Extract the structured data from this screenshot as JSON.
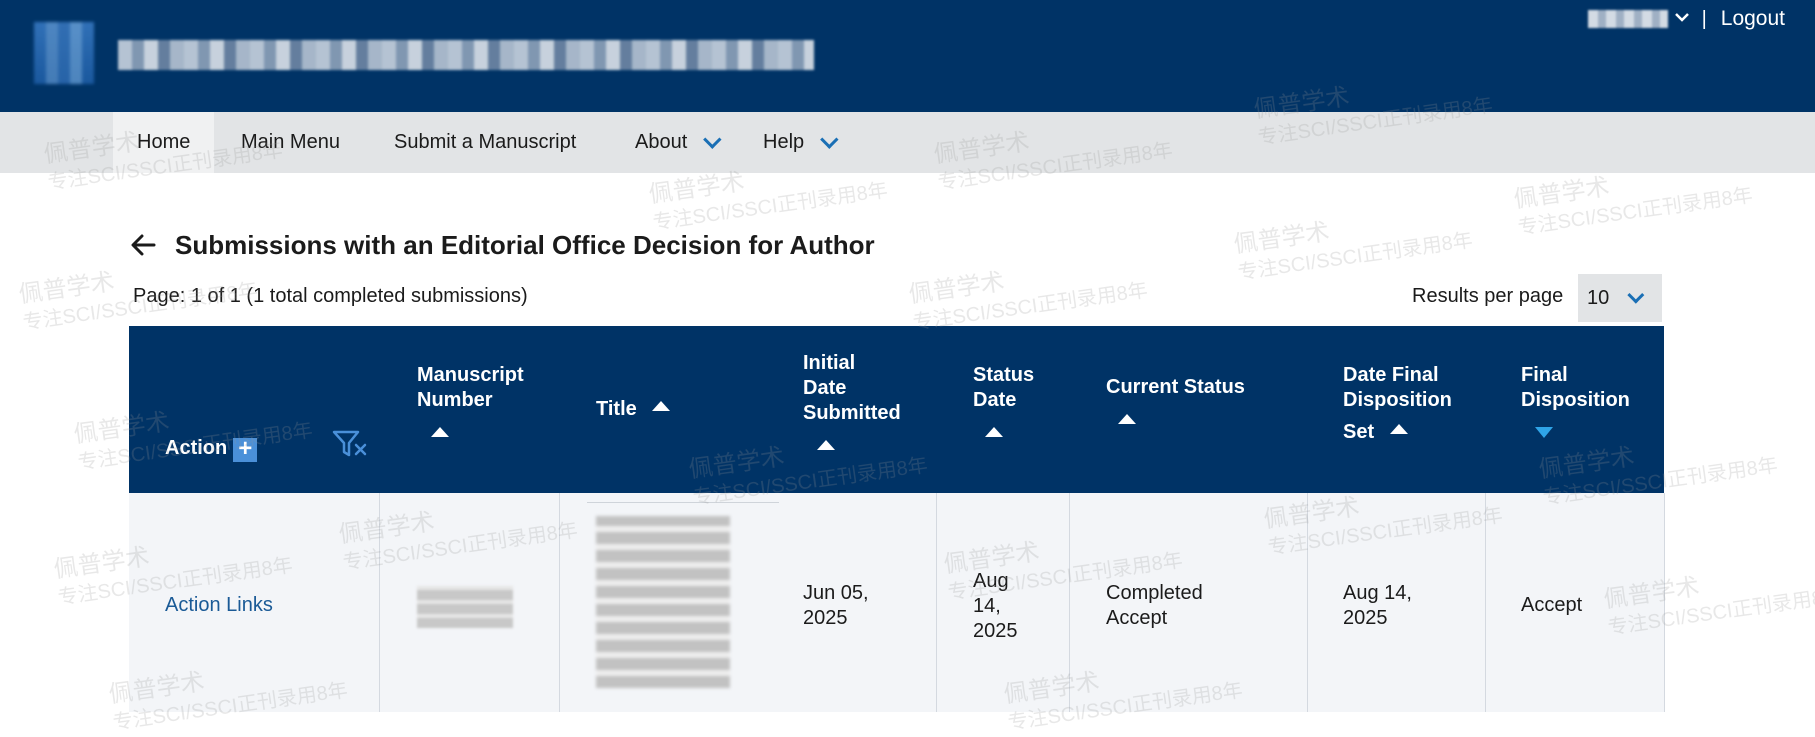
{
  "header": {
    "logout_label": "Logout",
    "separator": "|"
  },
  "nav": {
    "items": [
      {
        "label": "Home"
      },
      {
        "label": "Main Menu"
      },
      {
        "label": "Submit a Manuscript"
      },
      {
        "label": "About"
      },
      {
        "label": "Help"
      }
    ]
  },
  "page": {
    "title": "Submissions with an Editorial Office Decision for Author",
    "page_info": "Page: 1 of 1 (1 total completed submissions)",
    "results_per_page_label": "Results per page",
    "results_per_page_value": "10"
  },
  "table": {
    "headers": {
      "action": "Action",
      "action_add": "+",
      "manuscript_number_1": "Manuscript",
      "manuscript_number_2": "Number",
      "title": "Title",
      "initial_1": "Initial",
      "initial_2": "Date",
      "initial_3": "Submitted",
      "status_date_1": "Status",
      "status_date_2": "Date",
      "current_status": "Current Status",
      "date_final_1": "Date Final",
      "date_final_2": "Disposition",
      "date_final_3": "Set",
      "final_disp_1": "Final",
      "final_disp_2": "Disposition"
    },
    "row": {
      "action": "Action Links",
      "initial_1": "Jun 05,",
      "initial_2": "2025",
      "status_date_1": "Aug",
      "status_date_2": "14,",
      "status_date_3": "2025",
      "current_status_1": "Completed",
      "current_status_2": "Accept",
      "date_final_1": "Aug 14,",
      "date_final_2": "2025",
      "final_disposition": "Accept"
    }
  },
  "watermark": {
    "brand": "佩普学术",
    "tagline": "专注SCI/SSCI正刊录用8年"
  },
  "colors": {
    "header_bg": "#003366",
    "nav_bg": "#e2e4e6",
    "link": "#1a5a96",
    "sort_active": "#2fa4e7"
  }
}
